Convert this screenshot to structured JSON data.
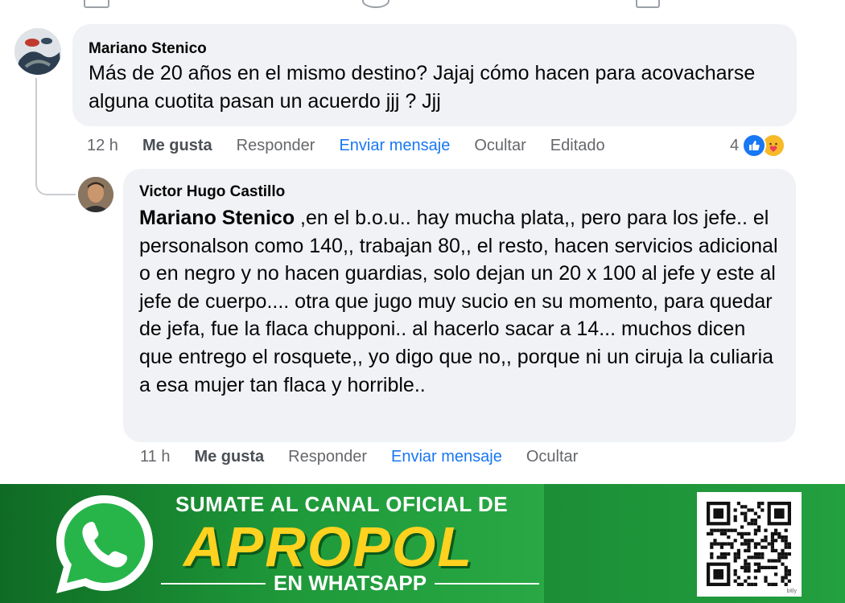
{
  "comments": [
    {
      "author": "Mariano Stenico",
      "text": "Más de 20 años en el mismo destino? Jajaj cómo hacen para acovacharse alguna cuotita pasan un acuerdo jjj ? Jjj",
      "time": "12 h",
      "actions": {
        "like": "Me gusta",
        "reply": "Responder",
        "message": "Enviar mensaje",
        "hide": "Ocultar",
        "edited": "Editado"
      },
      "reaction_count": "4",
      "reaction_icons": [
        "like-icon",
        "care-icon"
      ]
    },
    {
      "author": "Victor Hugo Castillo",
      "mention": "Mariano Stenico",
      "text": " ,en el b.o.u.. hay mucha plata,, pero para los jefe.. el personalson como 140,, trabajan 80,, el resto, hacen servicios adicional o en negro y no hacen guardias, solo dejan un 20 x 100 al jefe y este al jefe de cuerpo.... otra que jugo muy sucio en su momento, para quedar de jefa, fue la flaca chupponi.. al hacerlo sacar a 14... muchos dicen que entrego el rosquete,, yo digo que no,, porque ni un ciruja la culiaria a esa mujer tan flaca y horrible..",
      "time": "11 h",
      "actions": {
        "like": "Me gusta",
        "reply": "Responder",
        "message": "Enviar mensaje",
        "hide": "Ocultar"
      }
    }
  ],
  "banner": {
    "title": "SUMATE AL CANAL OFICIAL DE",
    "brand": "APROPOL",
    "subtitle": "EN WHATSAPP",
    "qr_label": "bitly"
  },
  "colors": {
    "link": "#1877f2",
    "muted": "#65676b",
    "bubble": "#f0f2f5",
    "banner_green": "#1f9a3a",
    "brand_yellow": "#ffd21f"
  }
}
